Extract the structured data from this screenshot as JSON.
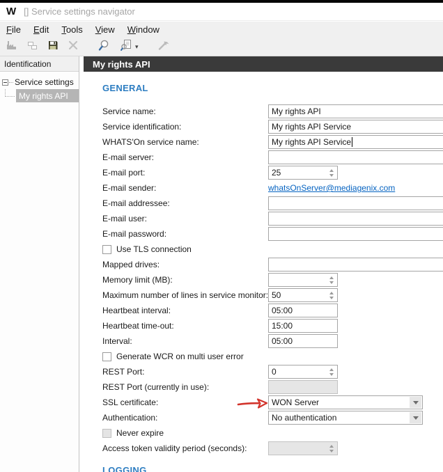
{
  "window": {
    "logo": "W",
    "title": "[] Service settings navigator"
  },
  "menu": {
    "items": [
      "File",
      "Edit",
      "Tools",
      "View",
      "Window"
    ]
  },
  "toolbar": {
    "buttons": [
      {
        "icon": "factory-icon",
        "enabled": false
      },
      {
        "icon": "copy-icon",
        "enabled": false
      },
      {
        "icon": "save-icon",
        "enabled": true
      },
      {
        "icon": "delete-icon",
        "enabled": false
      },
      {
        "icon": "search-icon",
        "enabled": true,
        "group_gap": true
      },
      {
        "icon": "search-list-icon",
        "enabled": true,
        "dropdown": true
      },
      {
        "icon": "tools-icon",
        "enabled": false,
        "group_gap": true
      }
    ]
  },
  "sidebar": {
    "header": "Identification",
    "tree": {
      "root": "Service settings",
      "child": "My rights API",
      "selected": "My rights API"
    }
  },
  "main": {
    "header": "My rights API",
    "sections": [
      {
        "title": "GENERAL"
      },
      {
        "title": "LOGGING"
      }
    ],
    "rows": [
      {
        "label": "Service name:",
        "type": "text",
        "value": "My rights API",
        "size": "wide"
      },
      {
        "label": "Service identification:",
        "type": "text",
        "value": "My rights API Service",
        "size": "wide"
      },
      {
        "label": "WHATS'On service name:",
        "type": "text",
        "value": "My rights API Service",
        "size": "wide",
        "caret": true
      },
      {
        "label": "E-mail server:",
        "type": "text",
        "value": "",
        "size": "wide"
      },
      {
        "label": "E-mail port:",
        "type": "spinner",
        "value": "25",
        "size": "narrow"
      },
      {
        "label": "E-mail sender:",
        "type": "link",
        "value": "whatsOnServer@mediagenix.com"
      },
      {
        "label": "E-mail addressee:",
        "type": "text",
        "value": "",
        "size": "wide"
      },
      {
        "label": "E-mail user:",
        "type": "text",
        "value": "",
        "size": "wide"
      },
      {
        "label": "E-mail password:",
        "type": "text",
        "value": "",
        "size": "wide"
      },
      {
        "label": "Use TLS connection",
        "type": "checkbox",
        "checked": false
      },
      {
        "label": "Mapped drives:",
        "type": "text",
        "value": "",
        "size": "wide"
      },
      {
        "label": "Memory limit (MB):",
        "type": "spinner",
        "value": "",
        "size": "narrow"
      },
      {
        "label": "Maximum number of lines in service monitor:",
        "type": "spinner",
        "value": "50",
        "size": "narrow"
      },
      {
        "label": "Heartbeat interval:",
        "type": "text",
        "value": "05:00",
        "size": "narrow"
      },
      {
        "label": "Heartbeat time-out:",
        "type": "text",
        "value": "15:00",
        "size": "narrow"
      },
      {
        "label": "Interval:",
        "type": "text",
        "value": "05:00",
        "size": "narrow"
      },
      {
        "label": "Generate WCR on multi user error",
        "type": "checkbox",
        "checked": false
      },
      {
        "label": "REST Port:",
        "type": "spinner",
        "value": "0",
        "size": "narrow"
      },
      {
        "label": "REST Port (currently in use):",
        "type": "text",
        "value": "",
        "size": "narrow",
        "disabled": true
      },
      {
        "label": "SSL certificate:",
        "type": "dropdown",
        "value": "WON Server",
        "annotation": "red-arrow"
      },
      {
        "label": "Authentication:",
        "type": "dropdown",
        "value": "No authentication"
      },
      {
        "label": "Never expire",
        "type": "checkbox",
        "checked": false,
        "disabled": true
      },
      {
        "label": "Access token validity period (seconds):",
        "type": "spinner",
        "value": "",
        "size": "narrow",
        "disabled": true
      }
    ]
  },
  "colors": {
    "section_blue": "#2d7dc1",
    "link_blue": "#0563c1",
    "header_dark": "#3a3a3a",
    "annotation_red": "#d2342c",
    "selection_grey": "#b5b5b5"
  }
}
